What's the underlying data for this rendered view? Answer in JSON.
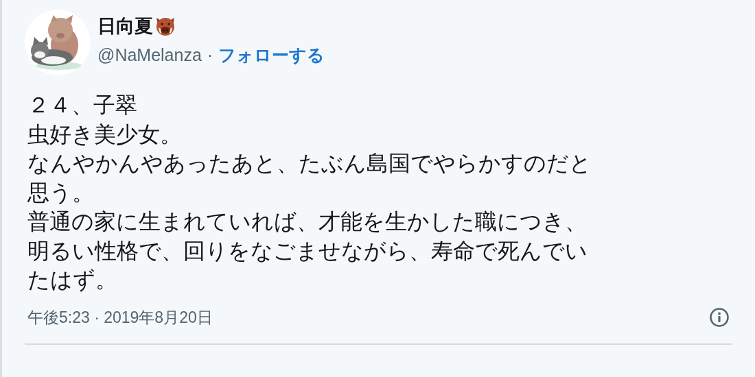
{
  "author": {
    "name": "日向夏",
    "handle": "@NaMelanza",
    "separator": "·",
    "follow": "フォローする"
  },
  "body_lines": [
    "２４、子翠",
    "虫好き美少女。",
    "なんやかんやあったあと、たぶん島国でやらかすのだと",
    "思う。",
    "普通の家に生まれていれば、才能を生かした職につき、",
    "明るい性格で、回りをなごませながら、寿命で死んでい",
    "たはず。"
  ],
  "timestamp": "午後5:23 · 2019年8月20日"
}
